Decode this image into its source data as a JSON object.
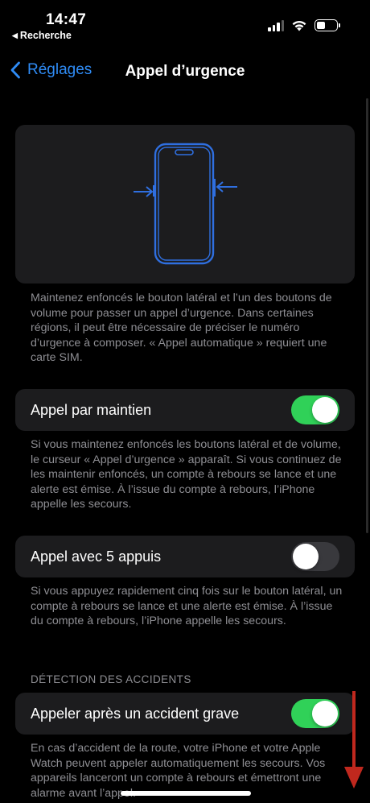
{
  "status_bar": {
    "time": "14:47",
    "back_app": "Recherche",
    "icons": [
      "cellular-signal-icon",
      "wifi-icon",
      "battery-icon"
    ]
  },
  "nav": {
    "back_label": "Réglages",
    "title": "Appel d’urgence"
  },
  "illustration": {
    "description_icon": "phone-side-buttons-icon",
    "accent_color": "#2f6fe0"
  },
  "intro_text": "Maintenez enfoncés le bouton latéral et l’un des boutons de volume pour passer un appel d’urgence. Dans certaines régions, il peut être nécessaire de préciser le numéro d’urgence à composer. « Appel automatique » requiert une carte SIM.",
  "settings": [
    {
      "label": "Appel par maintien",
      "on": true,
      "footer": "Si vous maintenez enfoncés les boutons latéral et de volume, le curseur « Appel d’urgence » apparaît. Si vous continuez de les maintenir enfoncés, un compte à rebours se lance et une alerte est émise. À l’issue du compte à rebours, l’iPhone appelle les secours."
    },
    {
      "label": "Appel avec 5 appuis",
      "on": false,
      "footer": "Si vous appuyez rapidement cinq fois sur le bouton latéral, un compte à rebours se lance et une alerte est émise. À l’issue du compte à rebours, l’iPhone appelle les secours."
    }
  ],
  "crash_section": {
    "header": "DÉTECTION DES ACCIDENTS",
    "label": "Appeler après un accident grave",
    "on": true,
    "footer": "En cas d’accident de la route, votre iPhone et votre Apple Watch peuvent appeler automatiquement les secours. Vos appareils lanceront un compte à rebours et émettront une alarme avant l’appel."
  },
  "colors": {
    "accent": "#2f8cf6",
    "toggle_on": "#30d158",
    "annotation_arrow": "#c0281e"
  }
}
